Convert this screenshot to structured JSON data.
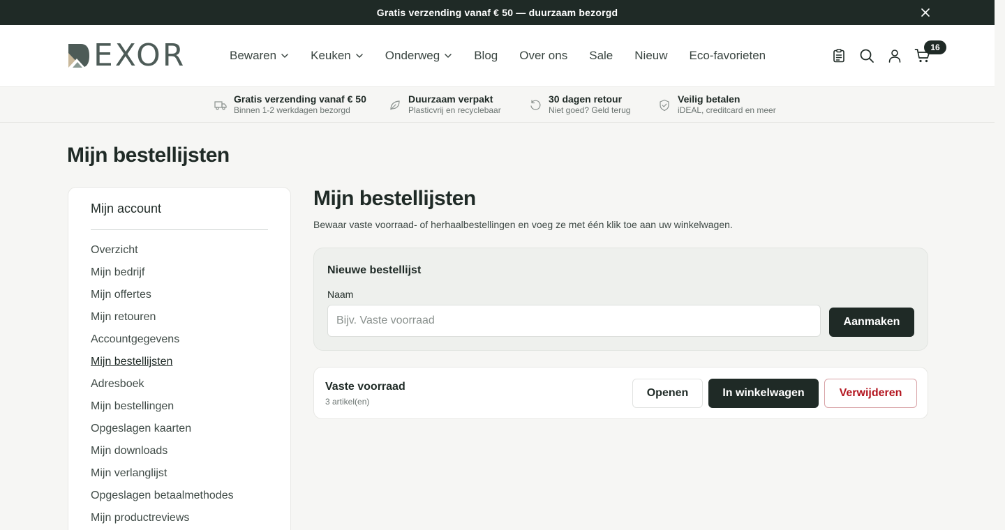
{
  "announcement": {
    "text": "Gratis verzending vanaf € 50 — duurzaam bezorgd",
    "close_icon": "close-icon"
  },
  "header": {
    "logo_text": "EXOR",
    "nav": [
      {
        "label": "Bewaren",
        "has_dropdown": true
      },
      {
        "label": "Keuken",
        "has_dropdown": true
      },
      {
        "label": "Onderweg",
        "has_dropdown": true
      },
      {
        "label": "Blog",
        "has_dropdown": false
      },
      {
        "label": "Over ons",
        "has_dropdown": false
      },
      {
        "label": "Sale",
        "has_dropdown": false
      },
      {
        "label": "Nieuw",
        "has_dropdown": false
      },
      {
        "label": "Eco-favorieten",
        "has_dropdown": false
      }
    ],
    "icons": [
      "clipboard-icon",
      "search-icon",
      "user-icon",
      "cart-icon"
    ],
    "cart_count": "16"
  },
  "usps": [
    {
      "title": "Gratis verzending vanaf € 50",
      "subtitle": "Binnen 1-2 werkdagen bezorgd",
      "icon": "truck-icon"
    },
    {
      "title": "Duurzaam verpakt",
      "subtitle": "Plasticvrij en recyclebaar",
      "icon": "leaf-icon"
    },
    {
      "title": "30 dagen retour",
      "subtitle": "Niet goed? Geld terug",
      "icon": "return-icon"
    },
    {
      "title": "Veilig betalen",
      "subtitle": "iDEAL, creditcard en meer",
      "icon": "shield-check-icon"
    }
  ],
  "page_title": "Mijn bestellijsten",
  "sidebar": {
    "title": "Mijn account",
    "items": [
      {
        "label": "Overzicht",
        "active": false
      },
      {
        "label": "Mijn bedrijf",
        "active": false
      },
      {
        "label": "Mijn offertes",
        "active": false
      },
      {
        "label": "Mijn retouren",
        "active": false
      },
      {
        "label": "Accountgegevens",
        "active": false
      },
      {
        "label": "Mijn bestellijsten",
        "active": true
      },
      {
        "label": "Adresboek",
        "active": false
      },
      {
        "label": "Mijn bestellingen",
        "active": false
      },
      {
        "label": "Opgeslagen kaarten",
        "active": false
      },
      {
        "label": "Mijn downloads",
        "active": false
      },
      {
        "label": "Mijn verlanglijst",
        "active": false
      },
      {
        "label": "Opgeslagen betaalmethodes",
        "active": false
      },
      {
        "label": "Mijn productreviews",
        "active": false
      }
    ]
  },
  "main": {
    "title": "Mijn bestellijsten",
    "description": "Bewaar vaste voorraad- of herhaalbestellingen en voeg ze met één klik toe aan uw winkelwagen.",
    "new_list": {
      "title": "Nieuwe bestellijst",
      "name_label": "Naam",
      "name_value": "",
      "name_placeholder": "Bijv. Vaste voorraad",
      "create_label": "Aanmaken"
    },
    "lists": [
      {
        "name": "Vaste voorraad",
        "count": "3 artikel(en)",
        "open_label": "Openen",
        "cart_label": "In winkelwagen",
        "delete_label": "Verwijderen"
      }
    ]
  },
  "colors": {
    "primary_dark": "#1f2a26",
    "danger": "#b3151f",
    "background": "#f6f6f4",
    "card_muted": "#eef0ed"
  }
}
